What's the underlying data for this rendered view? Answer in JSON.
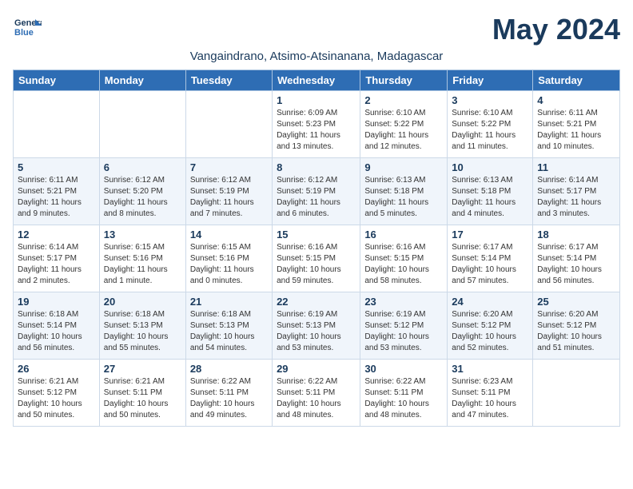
{
  "logo": {
    "line1": "General",
    "line2": "Blue"
  },
  "title": "May 2024",
  "subtitle": "Vangaindrano, Atsimo-Atsinanana, Madagascar",
  "days_of_week": [
    "Sunday",
    "Monday",
    "Tuesday",
    "Wednesday",
    "Thursday",
    "Friday",
    "Saturday"
  ],
  "weeks": [
    [
      {
        "day": "",
        "info": ""
      },
      {
        "day": "",
        "info": ""
      },
      {
        "day": "",
        "info": ""
      },
      {
        "day": "1",
        "info": "Sunrise: 6:09 AM\nSunset: 5:23 PM\nDaylight: 11 hours\nand 13 minutes."
      },
      {
        "day": "2",
        "info": "Sunrise: 6:10 AM\nSunset: 5:22 PM\nDaylight: 11 hours\nand 12 minutes."
      },
      {
        "day": "3",
        "info": "Sunrise: 6:10 AM\nSunset: 5:22 PM\nDaylight: 11 hours\nand 11 minutes."
      },
      {
        "day": "4",
        "info": "Sunrise: 6:11 AM\nSunset: 5:21 PM\nDaylight: 11 hours\nand 10 minutes."
      }
    ],
    [
      {
        "day": "5",
        "info": "Sunrise: 6:11 AM\nSunset: 5:21 PM\nDaylight: 11 hours\nand 9 minutes."
      },
      {
        "day": "6",
        "info": "Sunrise: 6:12 AM\nSunset: 5:20 PM\nDaylight: 11 hours\nand 8 minutes."
      },
      {
        "day": "7",
        "info": "Sunrise: 6:12 AM\nSunset: 5:19 PM\nDaylight: 11 hours\nand 7 minutes."
      },
      {
        "day": "8",
        "info": "Sunrise: 6:12 AM\nSunset: 5:19 PM\nDaylight: 11 hours\nand 6 minutes."
      },
      {
        "day": "9",
        "info": "Sunrise: 6:13 AM\nSunset: 5:18 PM\nDaylight: 11 hours\nand 5 minutes."
      },
      {
        "day": "10",
        "info": "Sunrise: 6:13 AM\nSunset: 5:18 PM\nDaylight: 11 hours\nand 4 minutes."
      },
      {
        "day": "11",
        "info": "Sunrise: 6:14 AM\nSunset: 5:17 PM\nDaylight: 11 hours\nand 3 minutes."
      }
    ],
    [
      {
        "day": "12",
        "info": "Sunrise: 6:14 AM\nSunset: 5:17 PM\nDaylight: 11 hours\nand 2 minutes."
      },
      {
        "day": "13",
        "info": "Sunrise: 6:15 AM\nSunset: 5:16 PM\nDaylight: 11 hours\nand 1 minute."
      },
      {
        "day": "14",
        "info": "Sunrise: 6:15 AM\nSunset: 5:16 PM\nDaylight: 11 hours\nand 0 minutes."
      },
      {
        "day": "15",
        "info": "Sunrise: 6:16 AM\nSunset: 5:15 PM\nDaylight: 10 hours\nand 59 minutes."
      },
      {
        "day": "16",
        "info": "Sunrise: 6:16 AM\nSunset: 5:15 PM\nDaylight: 10 hours\nand 58 minutes."
      },
      {
        "day": "17",
        "info": "Sunrise: 6:17 AM\nSunset: 5:14 PM\nDaylight: 10 hours\nand 57 minutes."
      },
      {
        "day": "18",
        "info": "Sunrise: 6:17 AM\nSunset: 5:14 PM\nDaylight: 10 hours\nand 56 minutes."
      }
    ],
    [
      {
        "day": "19",
        "info": "Sunrise: 6:18 AM\nSunset: 5:14 PM\nDaylight: 10 hours\nand 56 minutes."
      },
      {
        "day": "20",
        "info": "Sunrise: 6:18 AM\nSunset: 5:13 PM\nDaylight: 10 hours\nand 55 minutes."
      },
      {
        "day": "21",
        "info": "Sunrise: 6:18 AM\nSunset: 5:13 PM\nDaylight: 10 hours\nand 54 minutes."
      },
      {
        "day": "22",
        "info": "Sunrise: 6:19 AM\nSunset: 5:13 PM\nDaylight: 10 hours\nand 53 minutes."
      },
      {
        "day": "23",
        "info": "Sunrise: 6:19 AM\nSunset: 5:12 PM\nDaylight: 10 hours\nand 53 minutes."
      },
      {
        "day": "24",
        "info": "Sunrise: 6:20 AM\nSunset: 5:12 PM\nDaylight: 10 hours\nand 52 minutes."
      },
      {
        "day": "25",
        "info": "Sunrise: 6:20 AM\nSunset: 5:12 PM\nDaylight: 10 hours\nand 51 minutes."
      }
    ],
    [
      {
        "day": "26",
        "info": "Sunrise: 6:21 AM\nSunset: 5:12 PM\nDaylight: 10 hours\nand 50 minutes."
      },
      {
        "day": "27",
        "info": "Sunrise: 6:21 AM\nSunset: 5:11 PM\nDaylight: 10 hours\nand 50 minutes."
      },
      {
        "day": "28",
        "info": "Sunrise: 6:22 AM\nSunset: 5:11 PM\nDaylight: 10 hours\nand 49 minutes."
      },
      {
        "day": "29",
        "info": "Sunrise: 6:22 AM\nSunset: 5:11 PM\nDaylight: 10 hours\nand 48 minutes."
      },
      {
        "day": "30",
        "info": "Sunrise: 6:22 AM\nSunset: 5:11 PM\nDaylight: 10 hours\nand 48 minutes."
      },
      {
        "day": "31",
        "info": "Sunrise: 6:23 AM\nSunset: 5:11 PM\nDaylight: 10 hours\nand 47 minutes."
      },
      {
        "day": "",
        "info": ""
      }
    ]
  ]
}
